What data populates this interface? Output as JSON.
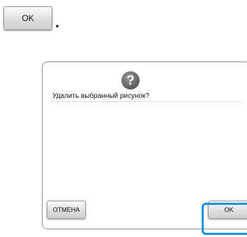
{
  "instruction": {
    "ok_button_label": "OK",
    "trailing_period": "."
  },
  "dialog": {
    "icon": "question-icon",
    "icon_glyph": "?",
    "message": "Удалить выбранный рисунок?",
    "cancel_label": "ОТМЕНА",
    "ok_label": "OK",
    "highlight_color": "#1e90e0"
  }
}
